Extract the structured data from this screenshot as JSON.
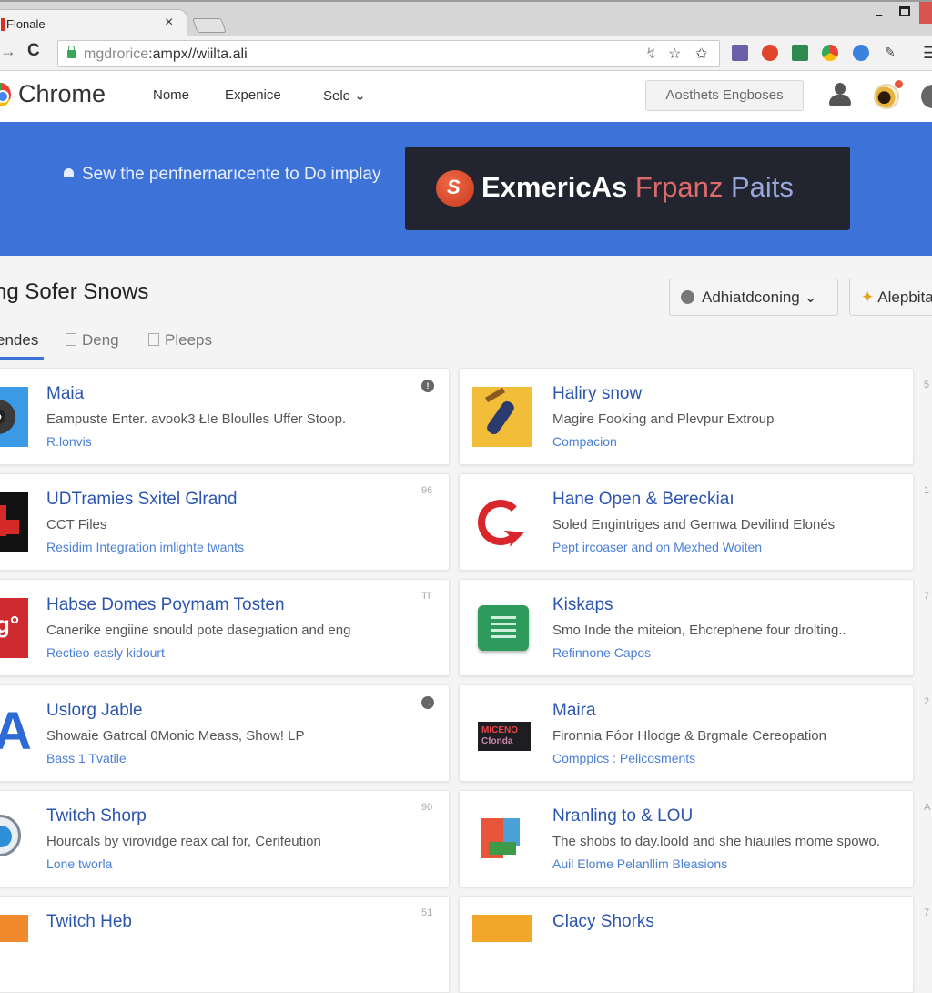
{
  "window": {
    "tab_title": "Flonale",
    "tab_close": "×",
    "minimize": "–",
    "url_dim": "mgdrorice",
    "url_main": ":ampx//wiilta.ali"
  },
  "toolbar": {
    "forward": "→",
    "reload": "C",
    "bookmark_icons": [
      "↯",
      "☆",
      "✩"
    ],
    "menu": "☰",
    "extensions": [
      {
        "name": "photo-extension",
        "color": "#6b5fa8"
      },
      {
        "name": "recorder-extension",
        "color": "#e2452e"
      },
      {
        "name": "grid-extension",
        "color": "#2f8a4f"
      },
      {
        "name": "chrome-extension",
        "color": "#e8782b"
      },
      {
        "name": "cd-extension",
        "color": "#3b82e0"
      },
      {
        "name": "pen-extension",
        "color": "#444444"
      }
    ]
  },
  "header": {
    "brand": "Chrome",
    "nav": [
      "Nome",
      "Expenice",
      "Sele ⌄"
    ],
    "action_button": "Aosthets Engboses"
  },
  "banner": {
    "text": "Sew the penfnernarıcente to Do implay",
    "promo_logo": "S",
    "promo_part1": "ExmericAs ",
    "promo_part2": "Frpanz ",
    "promo_part3": "Paits"
  },
  "section": {
    "title": "ng Sofer Snows",
    "filter_button": "Adhiatdconing ⌄",
    "secondary_button": "Alepbita",
    "tabs": [
      "endes",
      "Deng",
      "Pleeps"
    ]
  },
  "cards": {
    "left": [
      {
        "title": "Maia",
        "desc": "Eampuste Enter. avook3 Ł!e Bloulles Uffer Stoop.",
        "link": "R.lonvis",
        "meta": "!",
        "badge": true,
        "thumb": "fuzzball",
        "thumb_bg": "#3a9ae6"
      },
      {
        "title": "UDTramies Sxitel Glrand",
        "desc": "CCT Files",
        "link": "Residim Integration imlighte twants",
        "meta": "96",
        "badge": false,
        "thumb": "red-blocks",
        "thumb_bg": "#111111"
      },
      {
        "title": "Habse Domes Poymam Tosten",
        "desc": "Canerike engiine snould pote dasegıation and eng",
        "link": "Rectieo easly kidourt",
        "meta": "Tī",
        "badge": false,
        "thumb": "red-dots",
        "thumb_bg": "#cf2a2f"
      },
      {
        "title": "Uslorg Jable",
        "desc": "Showaie Gatrcal 0Monic Meass, Show! LP",
        "link": "Bass 1 Tvatile",
        "meta": "→",
        "badge": true,
        "thumb": "blue-a",
        "thumb_bg": "#ffffff"
      },
      {
        "title": "Twitch Shorp",
        "desc": "Hourcals by virovidge reax cal for, Cerifeution",
        "link": "Lone tworla",
        "meta": "90",
        "badge": false,
        "thumb": "blue-disc",
        "thumb_bg": "#ffffff"
      },
      {
        "title": "Twitch Heb",
        "desc": "",
        "link": "",
        "meta": "51",
        "badge": false,
        "thumb": "orange-tile",
        "thumb_bg": "#f08a2c"
      }
    ],
    "right": [
      {
        "title": "Haliry snow",
        "desc": "Magire Fooking and Plevpur Extroup",
        "link": "Compacion",
        "meta": "5",
        "thumb": "yellow-figure",
        "thumb_bg": "#f2be3a"
      },
      {
        "title": "Hane Open & Bereckiaı",
        "desc": "Soled Engintriges and Gemwa Devilind Elonés",
        "link": "Pept ircoaser and on Mexhed Woiten",
        "meta": "1",
        "thumb": "red-cursor",
        "thumb_bg": "#ffffff"
      },
      {
        "title": "Kiskaps",
        "desc": "Smo Inde the miteion, Ehcrephene four drolting..",
        "link": "Refinnone Capos",
        "meta": "7",
        "thumb": "green-doc",
        "thumb_bg": "#ffffff"
      },
      {
        "title": "Maira",
        "desc": "Fironnia Fóor Hlodge & Brgmale Cereopation",
        "link": "Comppics : Pelicosments",
        "meta": "2",
        "thumb": "rainbow-text",
        "thumb_bg": "#ffffff"
      },
      {
        "title": "Nranling to & LOU",
        "desc": "The shobs to day.loold and she hiauiles mome spowo.",
        "link": "Auil Elome Pelanllim Bleasions",
        "meta": "A",
        "thumb": "shield",
        "thumb_bg": "#ffffff"
      },
      {
        "title": "Clacy Shorks",
        "desc": "",
        "link": "",
        "meta": "7",
        "thumb": "orange-tile",
        "thumb_bg": "#f2a72a"
      }
    ]
  }
}
